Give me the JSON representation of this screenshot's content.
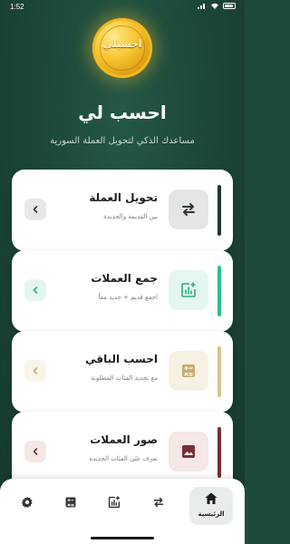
{
  "status_bar": {
    "time": "1:52"
  },
  "hero": {
    "coin_text": "احسبلي",
    "title": "احسب لي",
    "subtitle": "مساعدك الذكي لتحويل العملة السورية"
  },
  "cards": [
    {
      "title": "تحويل العملة",
      "description": "بين القديمة والجديدة",
      "icon": "swap-arrows-icon",
      "accent": "#1d3a30",
      "icon_bg": "#e4e6e5",
      "icon_color": "#2b3a34",
      "arrow_bg": "#e8e8e8",
      "arrow_color": "#333333"
    },
    {
      "title": "جمع العملات",
      "description": "اجمع قديم + جديد معاً",
      "icon": "chart-add-icon",
      "accent": "#2fbf87",
      "icon_bg": "#e3f7ee",
      "icon_color": "#2fae7c",
      "arrow_bg": "#e3f7ee",
      "arrow_color": "#2fae7c"
    },
    {
      "title": "احسب الباقي",
      "description": "مع تحديد الفئات المطلوبة",
      "icon": "calculator-icon",
      "accent": "#d8c38e",
      "icon_bg": "#f7f1e3",
      "icon_color": "#c7ad6e",
      "arrow_bg": "#f9f4e9",
      "arrow_color": "#c7ad6e"
    },
    {
      "title": "صور العملات",
      "description": "تعرف على الفئات الجديدة",
      "icon": "photo-icon",
      "accent": "#7b2e36",
      "icon_bg": "#f5e6e7",
      "icon_color": "#7b2e36",
      "arrow_bg": "#f5e6e7",
      "arrow_color": "#7b2e36"
    }
  ],
  "nav": {
    "home_label": "الرئيسية",
    "items": [
      "settings-icon",
      "calculator-icon",
      "chart-add-icon",
      "swap-arrows-icon",
      "home-icon"
    ]
  },
  "colors": {
    "background": "#1b4536",
    "card": "#ffffff",
    "coin": "#f7c531"
  }
}
